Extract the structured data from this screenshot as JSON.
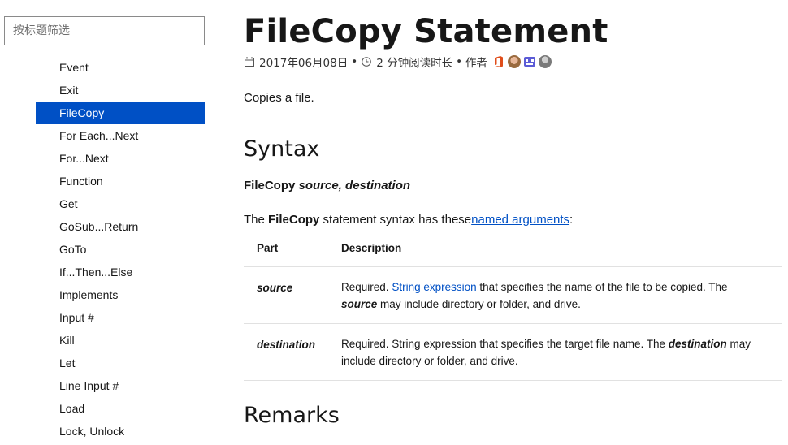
{
  "sidebar": {
    "filter_placeholder": "按标题筛选",
    "items": [
      {
        "label": "Event"
      },
      {
        "label": "Exit"
      },
      {
        "label": "FileCopy",
        "active": true
      },
      {
        "label": "For Each...Next"
      },
      {
        "label": "For...Next"
      },
      {
        "label": "Function"
      },
      {
        "label": "Get"
      },
      {
        "label": "GoSub...Return"
      },
      {
        "label": "GoTo"
      },
      {
        "label": "If...Then...Else"
      },
      {
        "label": "Implements"
      },
      {
        "label": "Input #"
      },
      {
        "label": "Kill"
      },
      {
        "label": "Let"
      },
      {
        "label": "Line Input #"
      },
      {
        "label": "Load"
      },
      {
        "label": "Lock, Unlock"
      }
    ]
  },
  "article": {
    "title": "FileCopy Statement",
    "meta": {
      "date": "2017年06月08日",
      "read_time": "2 分钟阅读时长",
      "author_label": "作者",
      "bullet": "•"
    },
    "intro": "Copies a file.",
    "syntax_heading": "Syntax",
    "syntax_keyword": "FileCopy",
    "syntax_args": "source, destination",
    "args_prefix": "The ",
    "args_keyword": "FileCopy",
    "args_middle": " statement syntax has these",
    "args_link": "named arguments",
    "args_suffix": ":",
    "table": {
      "headers": [
        "Part",
        "Description"
      ],
      "rows": [
        {
          "part": "source",
          "desc_prefix": "Required. ",
          "desc_link": "String expression",
          "desc_mid": " that specifies the name of the file to be copied. The ",
          "desc_em": "source",
          "desc_suffix": " may include directory or folder, and drive."
        },
        {
          "part": "destination",
          "desc_prefix": "Required. String expression that specifies the target file name. The ",
          "desc_em": "destination",
          "desc_suffix": " may include directory or folder, and drive."
        }
      ]
    },
    "remarks_heading": "Remarks"
  },
  "colors": {
    "accent": "#0050c5",
    "text": "#171717"
  }
}
